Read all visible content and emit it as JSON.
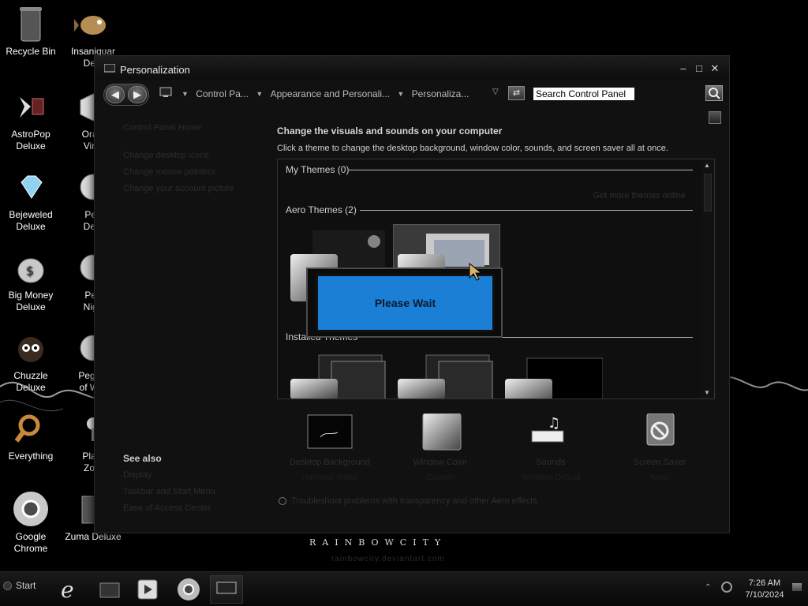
{
  "desktop": {
    "icons": [
      {
        "label": "Recycle Bin"
      },
      {
        "label": "Insaniquarium Deluxe",
        "shown": "Insaniquar Delu"
      },
      {
        "label": "AstroPop Deluxe"
      },
      {
        "label": "Oracle Virtual",
        "shown": "Oracl Virtu"
      },
      {
        "label": "Bejeweled Deluxe"
      },
      {
        "label": "Peggle Deluxe",
        "shown": "Peg Delu"
      },
      {
        "label": "Big Money Deluxe"
      },
      {
        "label": "Peggle Nights",
        "shown": "Peg Nigh"
      },
      {
        "label": "Chuzzle Deluxe"
      },
      {
        "label": "Peggle of War",
        "shown": "Peggle of War"
      },
      {
        "label": "Everything"
      },
      {
        "label": "Plants Zombies",
        "shown": "Plant Zom"
      },
      {
        "label": "Google Chrome"
      },
      {
        "label": "Zuma Deluxe"
      }
    ],
    "brand": "RAINBOWCITY",
    "brand_sub": "rainbowcity.deviantart.com"
  },
  "window": {
    "title": "Personalization",
    "controls": {
      "minimize": "–",
      "maximize": "□",
      "close": "✕"
    },
    "address": {
      "back": "◀",
      "forward": "▶",
      "crumbs": [
        "Control Pa...",
        "Appearance and Personali...",
        "Personaliza..."
      ],
      "search_value": "Search Control Panel"
    },
    "left": {
      "links": [
        "Control Panel Home",
        "Change desktop icons",
        "Change mouse pointers",
        "Change your account picture"
      ],
      "see_also_title": "See also",
      "see_also": [
        "Display",
        "Taskbar and Start Menu",
        "Ease of Access Center"
      ]
    },
    "main": {
      "heading": "Change the visuals and sounds on your computer",
      "subtext": "Click a theme to change the desktop background, window color, sounds, and screen saver all at once.",
      "groups": {
        "my_themes": "My Themes (0)",
        "aero_themes": "Aero Themes (2)",
        "installed_themes": "Installed Themes"
      },
      "get_more": "Get more themes online",
      "please_wait": "Please Wait"
    },
    "bottom": [
      {
        "label": "Desktop Background",
        "sub": "Harmony Slides"
      },
      {
        "label": "Window Color",
        "sub": "Custom"
      },
      {
        "label": "Sounds",
        "sub": "Windows Default"
      },
      {
        "label": "Screen Saver",
        "sub": "None"
      }
    ],
    "troubleshoot": "Troubleshoot problems with transparency and other Aero effects"
  },
  "taskbar": {
    "start": "Start",
    "time": "7:26 AM",
    "date": "7/10/2024",
    "tray_up": "⌃"
  },
  "colors": {
    "please_wait_bg": "#1b7fd5",
    "window_bg": "#111111",
    "desktop_bg": "#000000"
  }
}
